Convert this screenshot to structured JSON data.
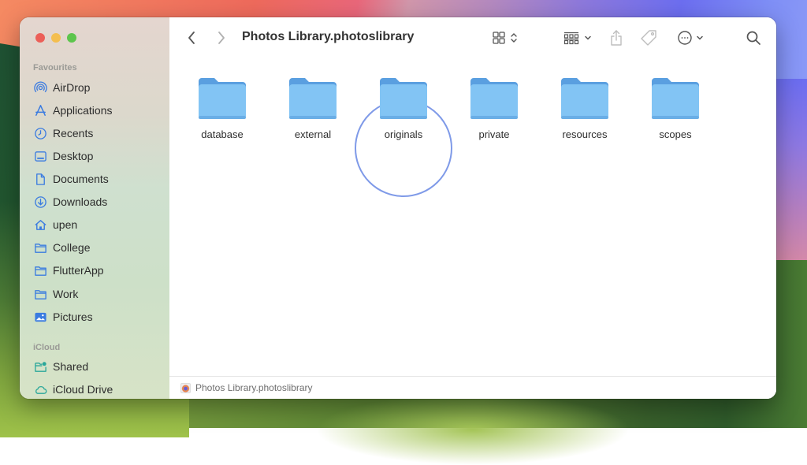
{
  "window": {
    "title": "Photos Library.photoslibrary"
  },
  "sidebar": {
    "sections": [
      {
        "label": "Favourites",
        "items": [
          {
            "label": "AirDrop",
            "icon": "airdrop-icon"
          },
          {
            "label": "Applications",
            "icon": "applications-icon"
          },
          {
            "label": "Recents",
            "icon": "clock-icon"
          },
          {
            "label": "Desktop",
            "icon": "desktop-icon"
          },
          {
            "label": "Documents",
            "icon": "document-icon"
          },
          {
            "label": "Downloads",
            "icon": "download-icon"
          },
          {
            "label": "upen",
            "icon": "home-icon"
          },
          {
            "label": "College",
            "icon": "folder-icon"
          },
          {
            "label": "FlutterApp",
            "icon": "folder-icon"
          },
          {
            "label": "Work",
            "icon": "folder-icon"
          },
          {
            "label": "Pictures",
            "icon": "pictures-icon"
          }
        ]
      },
      {
        "label": "iCloud",
        "items": [
          {
            "label": "Shared",
            "icon": "shared-folder-icon"
          },
          {
            "label": "iCloud Drive",
            "icon": "cloud-icon"
          }
        ]
      }
    ]
  },
  "toolbar": {
    "back": "back",
    "forward": "forward",
    "view_mode": "icon-view",
    "group": "group",
    "share": "share",
    "tags": "tags",
    "more": "more",
    "search": "search"
  },
  "folders": [
    {
      "name": "database",
      "highlighted": false
    },
    {
      "name": "external",
      "highlighted": false
    },
    {
      "name": "originals",
      "highlighted": true
    },
    {
      "name": "private",
      "highlighted": false
    },
    {
      "name": "resources",
      "highlighted": false
    },
    {
      "name": "scopes",
      "highlighted": false
    }
  ],
  "statusbar": {
    "path": "Photos Library.photoslibrary"
  },
  "colors": {
    "accent": "#3478f6",
    "folder": "#82c4f4",
    "folder_tab": "#5a9fe0",
    "highlight_ring": "#7f9ae8"
  }
}
